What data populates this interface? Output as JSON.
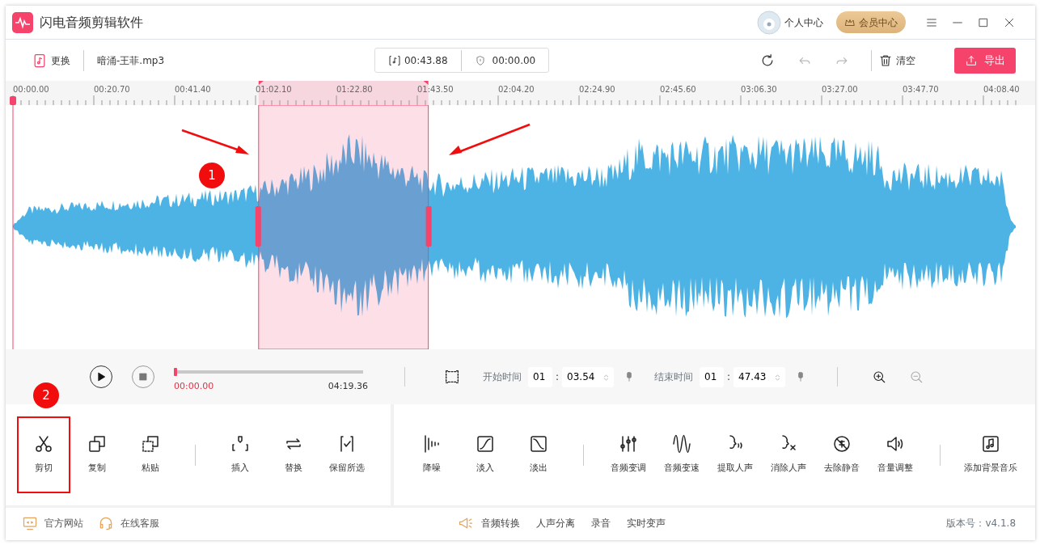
{
  "window": {
    "title": "闪电音频剪辑软件"
  },
  "title_bar": {
    "user": "个人中心",
    "vip": "会员中心"
  },
  "toolbar": {
    "replace": "更换",
    "filename": "暗涌-王菲.mp3",
    "selection_length": "00:43.88",
    "cursor_time": "00:00.00",
    "history": [
      {
        "kind": "refresh",
        "disabled": false
      },
      {
        "kind": "undo",
        "disabled": true
      },
      {
        "kind": "redo",
        "disabled": true
      }
    ],
    "clear": "清空",
    "export": "导出"
  },
  "ruler": {
    "labels": [
      "00:00.00",
      "00:20.70",
      "00:41.40",
      "01:02.10",
      "01:22.80",
      "01:43.50",
      "02:04.20",
      "02:24.90",
      "02:45.60",
      "03:06.30",
      "03:27.00",
      "03:47.70",
      "04:08.40"
    ]
  },
  "playback": {
    "level": 0,
    "current": "00:00.00",
    "total": "04:19.36"
  },
  "selection": {
    "start_label": "开始时间",
    "start_min": "01",
    "start_sec": "03.54",
    "end_label": "结束时间",
    "end_min": "01",
    "end_sec": "47.43",
    "colon": ":"
  },
  "zoom": [
    {
      "kind": "in",
      "disabled": false
    },
    {
      "kind": "out",
      "disabled": true
    }
  ],
  "tool_panels": [
    {
      "groups": [
        [
          {
            "label": "剪切",
            "highlighted": true
          },
          {
            "label": "复制",
            "highlighted": false
          },
          {
            "label": "粘贴",
            "highlighted": false
          }
        ],
        [
          {
            "label": "插入",
            "highlighted": false
          },
          {
            "label": "替换",
            "highlighted": false
          },
          {
            "label": "保留所选",
            "highlighted": false
          }
        ]
      ]
    },
    {
      "groups": [
        [
          {
            "label": "降噪",
            "highlighted": false
          },
          {
            "label": "淡入",
            "highlighted": false
          },
          {
            "label": "淡出",
            "highlighted": false
          }
        ],
        [
          {
            "label": "音频变调",
            "highlighted": false
          },
          {
            "label": "音频变速",
            "highlighted": false
          },
          {
            "label": "提取人声",
            "highlighted": false
          },
          {
            "label": "消除人声",
            "highlighted": false
          },
          {
            "label": "去除静音",
            "highlighted": false
          },
          {
            "label": "音量调整",
            "highlighted": false
          }
        ],
        [
          {
            "label": "添加背景音乐",
            "highlighted": false
          }
        ]
      ]
    }
  ],
  "footer": {
    "left": [
      "官方网站",
      "在线客服"
    ],
    "center": [
      "音频转换",
      "人声分离",
      "录音",
      "实时变声"
    ],
    "version": "版本号：v4.1.8"
  },
  "annotations": [
    "1",
    "2"
  ]
}
